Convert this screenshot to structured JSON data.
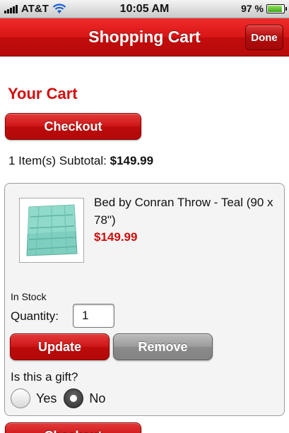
{
  "status_bar": {
    "carrier": "AT&T",
    "time": "10:05 AM",
    "battery": "97 %",
    "icons": [
      "signal-bars-icon",
      "wifi-icon",
      "battery-charging-icon"
    ]
  },
  "nav": {
    "title": "Shopping Cart",
    "done_label": "Done"
  },
  "cart": {
    "heading": "Your Cart",
    "checkout_label": "Checkout",
    "subtotal_prefix": "1 Item(s) Subtotal:",
    "subtotal_value": "$149.99"
  },
  "item": {
    "name": "Bed by Conran Throw - Teal (90 x 78\")",
    "price": "$149.99",
    "stock": "In Stock",
    "quantity_label": "Quantity:",
    "quantity_value": "1",
    "update_label": "Update",
    "remove_label": "Remove",
    "gift_question": "Is this a gift?",
    "gift_options": [
      "Yes",
      "No"
    ],
    "gift_selected": "No"
  },
  "colors": {
    "brand_red": "#d40d0d",
    "price_red": "#cc0d0d",
    "remove_gray": "#9c9c9c"
  }
}
